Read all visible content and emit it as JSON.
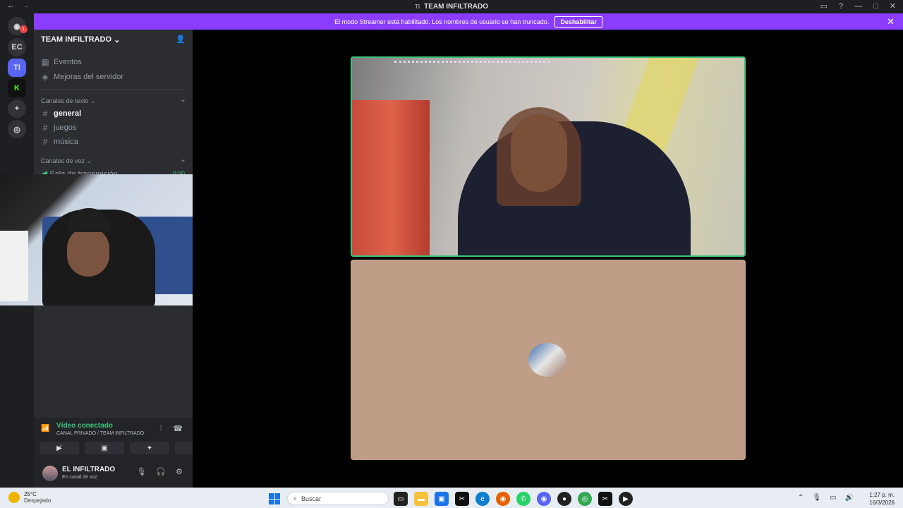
{
  "window": {
    "title": "TEAM INFILTRADO",
    "title_prefix": "TI"
  },
  "banner": {
    "text": "El modo Streamer está habilitado. Los nombres de usuario se han truncado.",
    "button": "Deshabilitar"
  },
  "rail": {
    "ec_label": "EC",
    "ti_label": "TI",
    "badge": "1"
  },
  "server": {
    "name": "TEAM INFILTRADO",
    "items": [
      {
        "label": "Eventos"
      },
      {
        "label": "Mejoras del servidor"
      }
    ],
    "text_category": "Canales de texto",
    "text_channels": [
      {
        "label": "general"
      },
      {
        "label": "juegos"
      },
      {
        "label": "música"
      }
    ],
    "voice_category": "Canales de voz",
    "voice_channel": "Sala de transmisión",
    "voice_time": "0:00"
  },
  "voice_status": {
    "title": "Vídeo conectado",
    "subtitle": "CANAL PRIVADO / TEAM INFILTRADO"
  },
  "user": {
    "name": "EL INFILTRADO",
    "status": "En canal de voz"
  },
  "taskbar": {
    "temp": "25°C",
    "weather": "Despejado",
    "search_placeholder": "Buscar",
    "time": "1:27 p. m.",
    "date": "16/3/2026"
  },
  "colors": {
    "accent": "#8b3dff",
    "connected": "#3fc37c",
    "tile_bg": "#bf9d86"
  }
}
